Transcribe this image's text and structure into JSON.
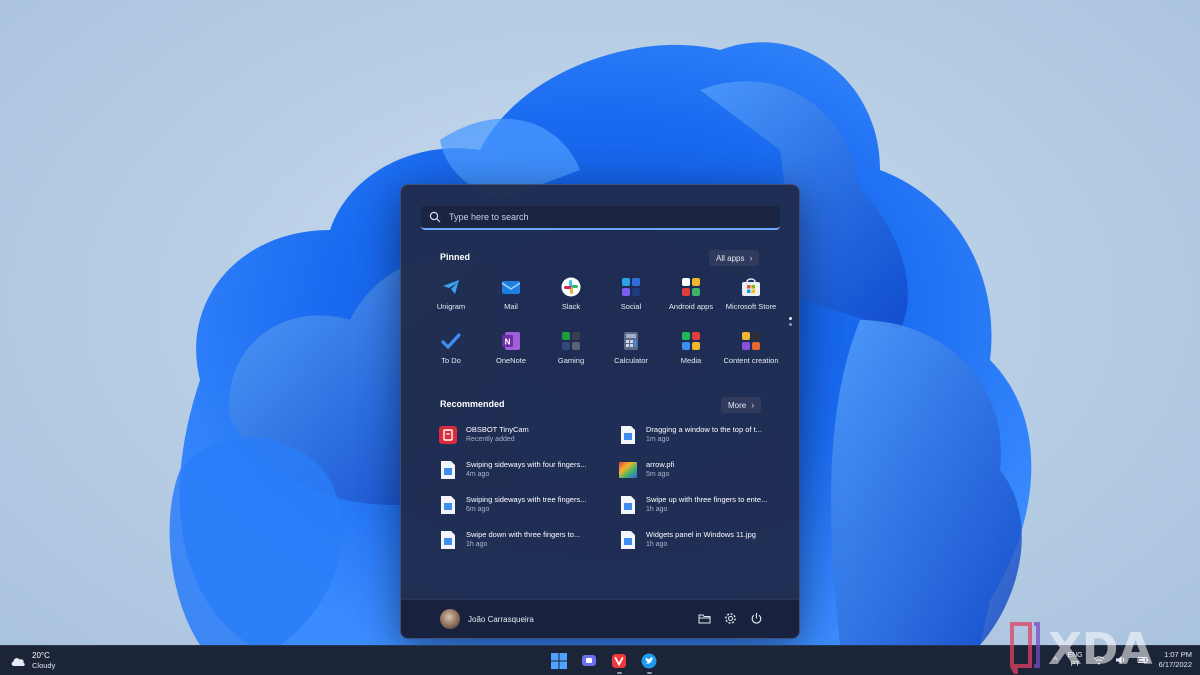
{
  "start_menu": {
    "search_placeholder": "Type here to search",
    "pinned": {
      "title": "Pinned",
      "all_apps_label": "All apps",
      "apps": [
        {
          "label": "Unigram",
          "icon": "unigram-icon"
        },
        {
          "label": "Mail",
          "icon": "mail-icon"
        },
        {
          "label": "Slack",
          "icon": "slack-icon"
        },
        {
          "label": "Social",
          "icon": "social-folder-icon"
        },
        {
          "label": "Android apps",
          "icon": "android-apps-folder-icon"
        },
        {
          "label": "Microsoft Store",
          "icon": "microsoft-store-icon"
        },
        {
          "label": "To Do",
          "icon": "todo-icon"
        },
        {
          "label": "OneNote",
          "icon": "onenote-icon"
        },
        {
          "label": "Gaming",
          "icon": "gaming-folder-icon"
        },
        {
          "label": "Calculator",
          "icon": "calculator-icon"
        },
        {
          "label": "Media",
          "icon": "media-folder-icon"
        },
        {
          "label": "Content creation",
          "icon": "content-creation-folder-icon"
        }
      ]
    },
    "recommended": {
      "title": "Recommended",
      "more_label": "More",
      "items": [
        {
          "name": "OBSBOT TinyCam",
          "time": "Recently added",
          "icon": "obsbot-icon"
        },
        {
          "name": "Dragging a window to the top of t...",
          "time": "1m ago",
          "icon": "image-file-icon"
        },
        {
          "name": "Swiping sideways with four fingers...",
          "time": "4m ago",
          "icon": "image-file-icon"
        },
        {
          "name": "arrow.pfi",
          "time": "5m ago",
          "icon": "gradient-file-icon"
        },
        {
          "name": "Swiping sideways with tree fingers...",
          "time": "6m ago",
          "icon": "image-file-icon"
        },
        {
          "name": "Swipe up with three fingers to ente...",
          "time": "1h ago",
          "icon": "image-file-icon"
        },
        {
          "name": "Swipe down with three fingers to...",
          "time": "1h ago",
          "icon": "image-file-icon"
        },
        {
          "name": "Widgets panel in Windows 11.jpg",
          "time": "1h ago",
          "icon": "image-file-icon"
        }
      ]
    },
    "user": {
      "name": "João Carrasqueira"
    }
  },
  "taskbar": {
    "weather": {
      "temp": "20°C",
      "condition": "Cloudy"
    },
    "lang_top": "ENG",
    "lang_bottom": "PT",
    "time": "1:07 PM",
    "date": "6/17/2022"
  },
  "watermark": "XDA"
}
